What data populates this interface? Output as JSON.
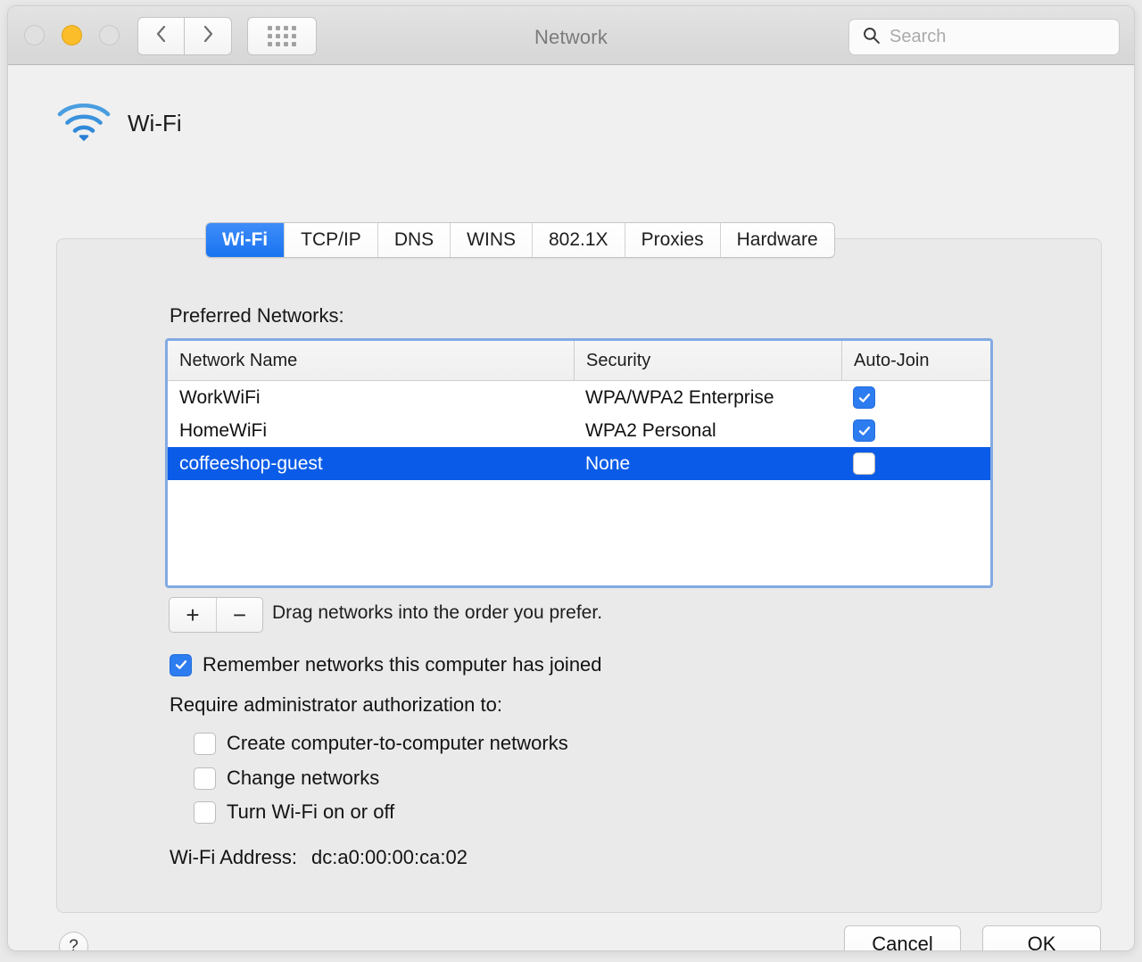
{
  "window": {
    "title": "Network",
    "traffic_lights": [
      {
        "name": "close",
        "state": "disabled"
      },
      {
        "name": "minimize",
        "state": "amber"
      },
      {
        "name": "zoom",
        "state": "disabled"
      }
    ],
    "nav": {
      "back_icon": "chevron-left-icon",
      "forward_icon": "chevron-right-icon",
      "grid_icon": "grid-view-icon"
    }
  },
  "search": {
    "placeholder": "Search",
    "icon": "search-icon",
    "value": ""
  },
  "pane": {
    "title": "Wi-Fi",
    "icon": "wifi-icon"
  },
  "tabs": [
    {
      "label": "Wi-Fi",
      "active": true
    },
    {
      "label": "TCP/IP",
      "active": false
    },
    {
      "label": "DNS",
      "active": false
    },
    {
      "label": "WINS",
      "active": false
    },
    {
      "label": "802.1X",
      "active": false
    },
    {
      "label": "Proxies",
      "active": false
    },
    {
      "label": "Hardware",
      "active": false
    }
  ],
  "preferred_networks": {
    "label": "Preferred Networks:",
    "columns": [
      "Network Name",
      "Security",
      "Auto-Join"
    ],
    "rows": [
      {
        "name": "WorkWiFi",
        "security": "WPA/WPA2 Enterprise",
        "auto_join": true,
        "selected": false
      },
      {
        "name": "HomeWiFi",
        "security": "WPA2 Personal",
        "auto_join": true,
        "selected": false
      },
      {
        "name": "coffeeshop-guest",
        "security": "None",
        "auto_join": false,
        "selected": true
      }
    ]
  },
  "list_controls": {
    "add_label": "+",
    "remove_label": "−",
    "hint": "Drag networks into the order you prefer."
  },
  "options": {
    "remember": {
      "label": "Remember networks this computer has joined",
      "checked": true
    },
    "admin_heading": "Require administrator authorization to:",
    "admin_items": [
      {
        "label": "Create computer-to-computer networks",
        "checked": false
      },
      {
        "label": "Change networks",
        "checked": false
      },
      {
        "label": "Turn Wi-Fi on or off",
        "checked": false
      }
    ]
  },
  "wifi_address": {
    "label": "Wi-Fi Address:",
    "value": "dc:a0:00:00:ca:02"
  },
  "footer": {
    "help_label": "?",
    "cancel_label": "Cancel",
    "ok_label": "OK"
  },
  "colors": {
    "accent_blue": "#0a5ce8",
    "tab_blue": "#1874f0",
    "checkbox_blue": "#2d7cf0",
    "focus_ring": "#82aae2",
    "amber": "#fcbd2b"
  }
}
